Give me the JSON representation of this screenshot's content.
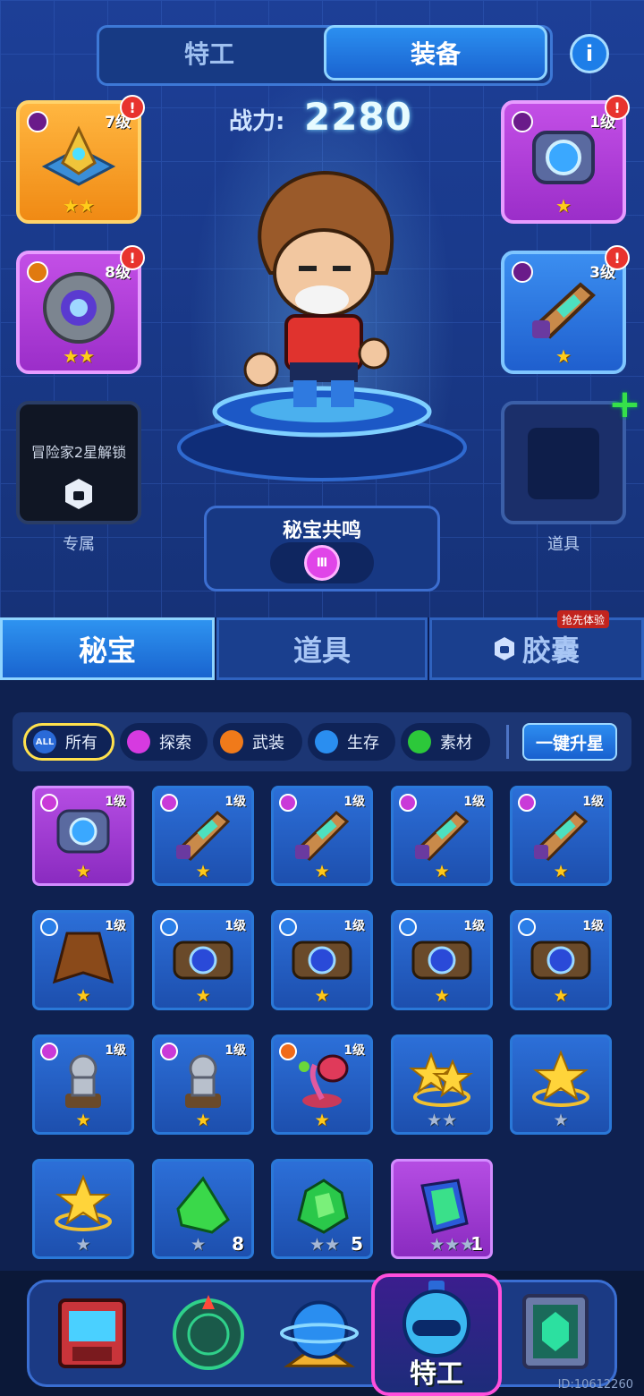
{
  "top_tabs": {
    "agent": "特工",
    "equipment": "装备"
  },
  "info_button": "i",
  "power": {
    "label": "战力:",
    "value": "2280"
  },
  "slots": {
    "left1": {
      "level": "7级",
      "stars": "★★",
      "alert": "!",
      "color": "#f08a14"
    },
    "left2": {
      "level": "8级",
      "stars": "★★",
      "alert": "!"
    },
    "left3": {
      "lock_text": "冒险家2星解锁",
      "label": "专属"
    },
    "right1": {
      "level": "1级",
      "stars": "★",
      "alert": "!"
    },
    "right2": {
      "level": "3级",
      "stars": "★",
      "alert": "!"
    },
    "right3": {
      "label": "道具",
      "add": "+"
    }
  },
  "resonance": {
    "title": "秘宝共鸣",
    "tier": "Ⅲ"
  },
  "mid_tabs": {
    "treasure": "秘宝",
    "items": "道具",
    "capsule": "胶囊",
    "capsule_tag": "抢先体验"
  },
  "filters": {
    "all_icon": "ALL",
    "all": "所有",
    "explore": "探索",
    "armed": "武装",
    "survive": "生存",
    "material": "素材",
    "upstar": "一键升星"
  },
  "cards": [
    {
      "level": "1级",
      "stars": "★",
      "type": "explore",
      "item": "core-device",
      "purple": true
    },
    {
      "level": "1级",
      "stars": "★",
      "type": "explore",
      "item": "blaster"
    },
    {
      "level": "1级",
      "stars": "★",
      "type": "explore",
      "item": "blaster"
    },
    {
      "level": "1级",
      "stars": "★",
      "type": "explore",
      "item": "blaster"
    },
    {
      "level": "1级",
      "stars": "★",
      "type": "explore",
      "item": "blaster"
    },
    {
      "level": "1级",
      "stars": "★",
      "type": "survive",
      "item": "cloak"
    },
    {
      "level": "1级",
      "stars": "★",
      "type": "survive",
      "item": "shield-box"
    },
    {
      "level": "1级",
      "stars": "★",
      "type": "survive",
      "item": "shield-box"
    },
    {
      "level": "1级",
      "stars": "★",
      "type": "survive",
      "item": "shield-box"
    },
    {
      "level": "1级",
      "stars": "★",
      "type": "survive",
      "item": "shield-box"
    },
    {
      "level": "1级",
      "stars": "★",
      "type": "explore",
      "item": "statue"
    },
    {
      "level": "1级",
      "stars": "★",
      "type": "explore",
      "item": "statue"
    },
    {
      "level": "1级",
      "stars": "★",
      "type": "armed",
      "item": "plant"
    },
    {
      "level": "",
      "stars": "★★",
      "type": "none",
      "item": "double-star",
      "grey": true
    },
    {
      "level": "",
      "stars": "★",
      "type": "none",
      "item": "star",
      "grey": true
    },
    {
      "level": "",
      "stars": "★",
      "type": "none",
      "item": "star",
      "grey": true
    },
    {
      "level": "",
      "stars": "★",
      "count": "8",
      "type": "none",
      "item": "green-crystal",
      "grey": true
    },
    {
      "level": "",
      "stars": "★★",
      "count": "5",
      "type": "none",
      "item": "green-crystal-cluster",
      "grey": true
    },
    {
      "level": "",
      "stars": "★★★",
      "count": "1",
      "type": "none",
      "item": "purple-crystal",
      "grey": true,
      "purple": true
    }
  ],
  "nav": {
    "active_label": "特工"
  },
  "uid": "ID:10612260"
}
